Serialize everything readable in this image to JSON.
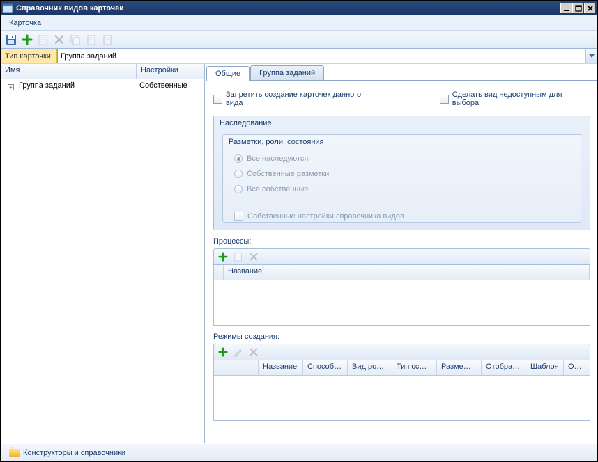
{
  "window": {
    "title": "Справочник видов карточек"
  },
  "menu": {
    "card": "Карточка"
  },
  "card_type": {
    "label": "Тип карточки:",
    "value": "Группа заданий"
  },
  "tree": {
    "columns": {
      "name": "Имя",
      "settings": "Настройки"
    },
    "rows": [
      {
        "name": "Группа заданий",
        "settings": "Собственные"
      }
    ]
  },
  "tabs": {
    "general": "Общие",
    "group": "Группа заданий"
  },
  "checks": {
    "forbid": "Запретить создание карточек данного вида",
    "unavailable": "Сделать вид недоступным для выбора"
  },
  "inheritance": {
    "title": "Наследование",
    "subtitle": "Разметки, роли, состояния",
    "options": {
      "all_inherited": "Все наследуются",
      "own_layouts": "Собственные разметки",
      "all_own": "Все собственные"
    },
    "own_settings": "Собственные настройки справочника видов"
  },
  "processes": {
    "label": "Процессы:",
    "columns": {
      "name": "Название"
    }
  },
  "modes": {
    "label": "Режимы создания:",
    "columns": {
      "name": "Название",
      "method": "Способ с...",
      "parent_kind": "Вид роди...",
      "link_type": "Тип ссылки",
      "placement": "Размеще...",
      "display": "Отображ...",
      "template": "Шаблон",
      "operations": "Операци..."
    }
  },
  "statusbar": {
    "constructors": "Конструкторы и справочники"
  }
}
